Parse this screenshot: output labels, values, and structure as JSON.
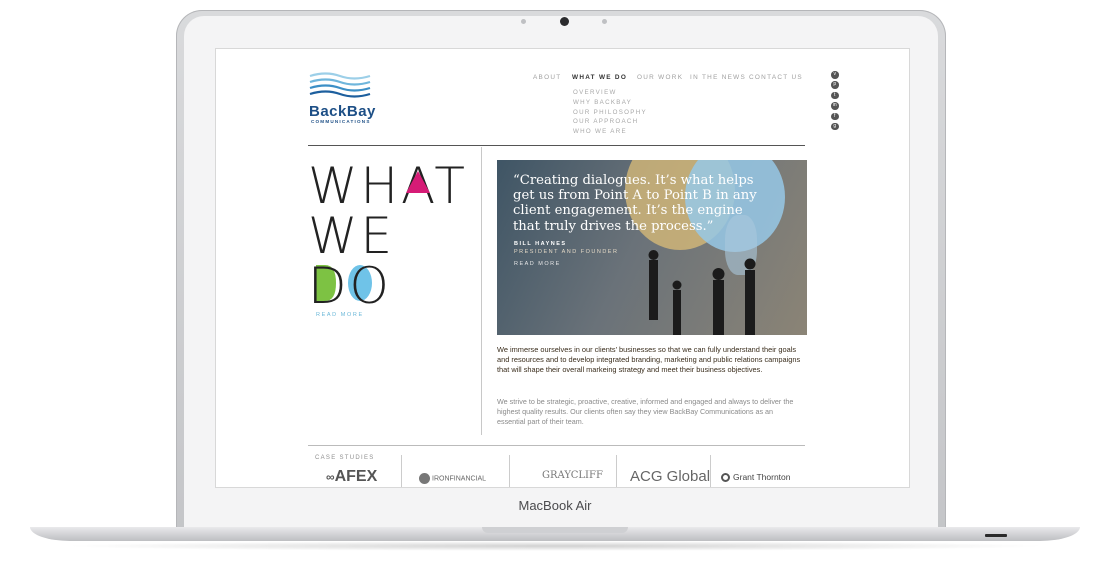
{
  "device": {
    "brand_label": "MacBook Air"
  },
  "site": {
    "logo": {
      "name": "BackBay",
      "sub": "COMMUNICATIONS"
    },
    "nav": [
      {
        "label": "ABOUT"
      },
      {
        "label": "WHAT WE DO",
        "active": true
      },
      {
        "label": "OUR WORK"
      },
      {
        "label": "IN THE NEWS"
      },
      {
        "label": "CONTACT US"
      }
    ],
    "subnav": [
      "OVERVIEW",
      "WHY BACKBAY",
      "OUR PHILOSOPHY",
      "OUR APPROACH",
      "WHO WE ARE"
    ],
    "social_icons": [
      "vimeo-icon",
      "pinterest-icon",
      "twitter-icon",
      "linkedin-icon",
      "facebook-icon",
      "google-plus-icon"
    ],
    "headline": {
      "line1": "WHAT",
      "line2": "WE",
      "line3": "DO"
    },
    "read_more_left": "READ MORE",
    "quote": {
      "text": "“Creating dialogues. It’s what helps get us from Point A to Point B in any client engagement. It’s the engine that truly drives the process.”",
      "name": "BILL HAYNES",
      "title": "PRESIDENT AND FOUNDER",
      "read_more": "READ MORE"
    },
    "paragraph1": "We immerse ourselves in our clients’ businesses so that we can fully understand their goals and resources and to develop integrated branding, marketing and public relations campaigns that will shape their overall markeing strategy and meet their business objectives.",
    "paragraph2": "We strive to be strategic, proactive, creative, informed and engaged and always to deliver the highest quality results. Our clients often say they view BackBay Communications as an essential part of their team.",
    "case_studies": {
      "label": "CASE STUDIES",
      "logos": [
        "AFEX",
        "IRONFINANCIAL",
        "GRAYCLIFF",
        "ACG Global",
        "Grant Thornton"
      ]
    },
    "colors": {
      "brand_blue": "#1d4f86",
      "accent_magenta": "#d61b76",
      "accent_green": "#7dc243",
      "accent_blue": "#6fc3e8",
      "link_blue": "#6ab7d8"
    }
  }
}
